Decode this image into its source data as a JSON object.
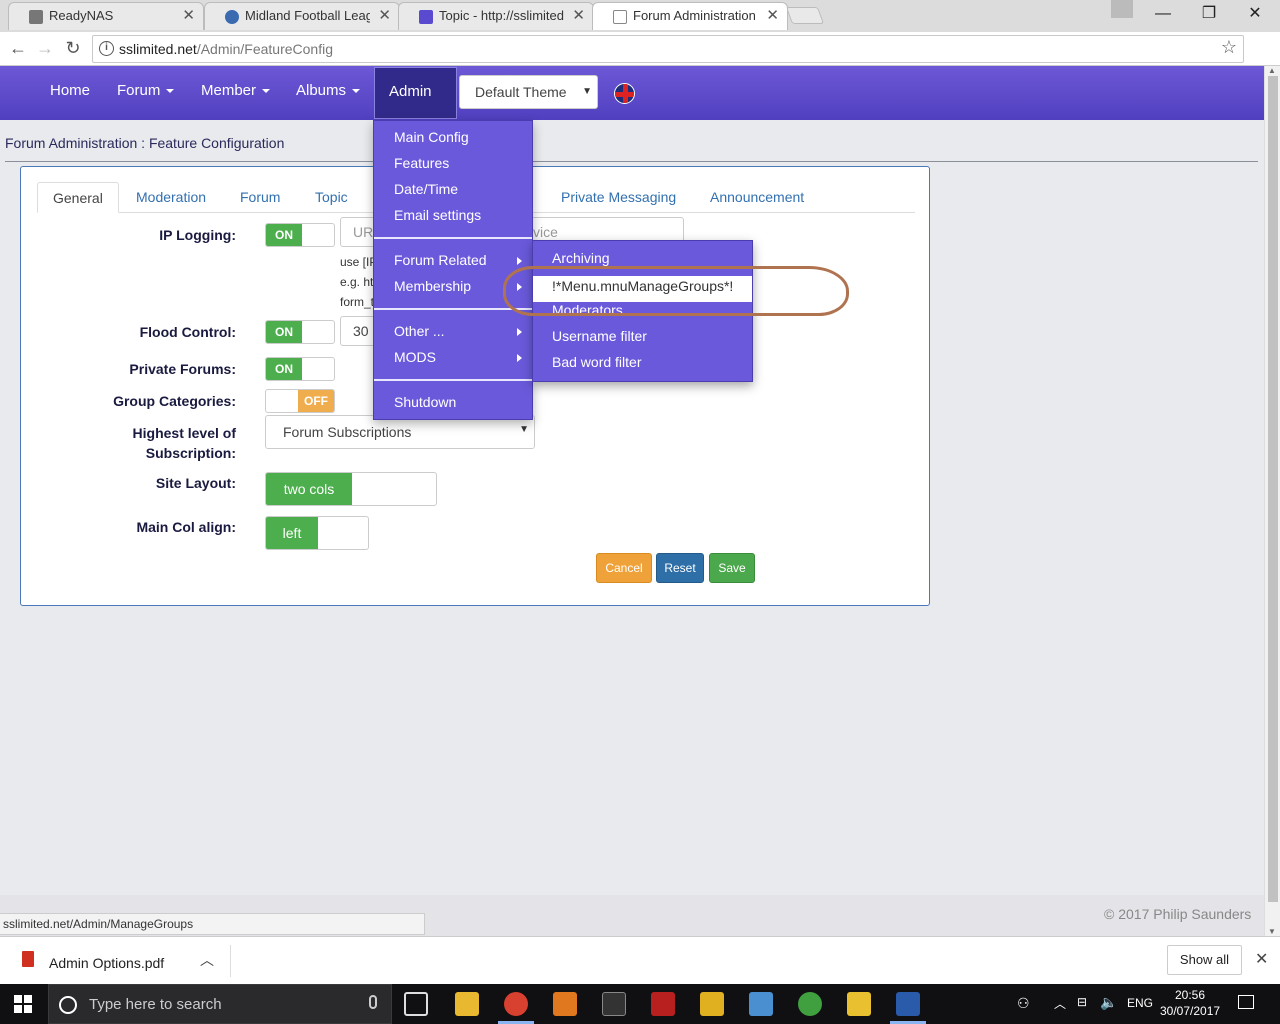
{
  "browser": {
    "tabs": [
      {
        "title": "ReadyNAS",
        "active": false
      },
      {
        "title": "Midland Football League",
        "active": false
      },
      {
        "title": "Topic - http://sslimited.n",
        "active": false
      },
      {
        "title": "Forum Administration : F",
        "active": true
      }
    ],
    "url_host": "sslimited.net",
    "url_path": "/Admin/FeatureConfig",
    "status_url": "sslimited.net/Admin/ManageGroups"
  },
  "nav": {
    "items": [
      {
        "label": "Home"
      },
      {
        "label": "Forum"
      },
      {
        "label": "Member"
      },
      {
        "label": "Albums"
      },
      {
        "label": "Admin"
      }
    ],
    "theme": "Default Theme"
  },
  "breadcrumb": "Forum Administration : Feature Configuration",
  "tabs": [
    "General",
    "Moderation",
    "Forum",
    "Topic",
    "Private Messaging",
    "Announcement"
  ],
  "form": {
    "ip_logging": {
      "label": "IP Logging:",
      "state": "ON",
      "placeholder": "UR",
      "placeholder2": "vice",
      "help1": "use [IP",
      "help2": "e.g. htt",
      "help3": "form_t"
    },
    "flood_control": {
      "label": "Flood Control:",
      "state": "ON",
      "value": "30"
    },
    "private_forums": {
      "label": "Private Forums:",
      "state": "ON"
    },
    "group_categories": {
      "label": "Group Categories:",
      "state": "OFF"
    },
    "highest_subscription": {
      "label1": "Highest level of",
      "label2": "Subscription:",
      "value": "Forum Subscriptions"
    },
    "site_layout": {
      "label": "Site Layout:",
      "value": "two cols"
    },
    "main_col_align": {
      "label": "Main Col align:",
      "value": "left"
    },
    "buttons": {
      "cancel": "Cancel",
      "reset": "Reset",
      "save": "Save"
    }
  },
  "admin_menu": {
    "group1": [
      "Main Config",
      "Features",
      "Date/Time",
      "Email settings"
    ],
    "group2": [
      "Forum Related",
      "Membership"
    ],
    "group3": [
      "Other ...",
      "MODS"
    ],
    "group4": [
      "Shutdown"
    ]
  },
  "sub_menu": {
    "items": [
      "Archiving",
      "!*Menu.mnuManageGroups*!",
      "Moderators",
      "Username filter",
      "Bad word filter"
    ]
  },
  "footer": "© 2017 Philip Saunders",
  "download": {
    "file": "Admin Options.pdf",
    "show_all": "Show all"
  },
  "taskbar": {
    "search_placeholder": "Type here to search",
    "lang": "ENG",
    "time": "20:56",
    "date": "30/07/2017"
  },
  "colors": {
    "navbar": "#5e4ccd",
    "menu": "#6a5adb",
    "on": "#4cae4c",
    "off": "#f0ad4e",
    "cancel": "#f0ad4e",
    "reset": "#337ab7",
    "save": "#5cb85c",
    "annotation": "#b07350"
  }
}
